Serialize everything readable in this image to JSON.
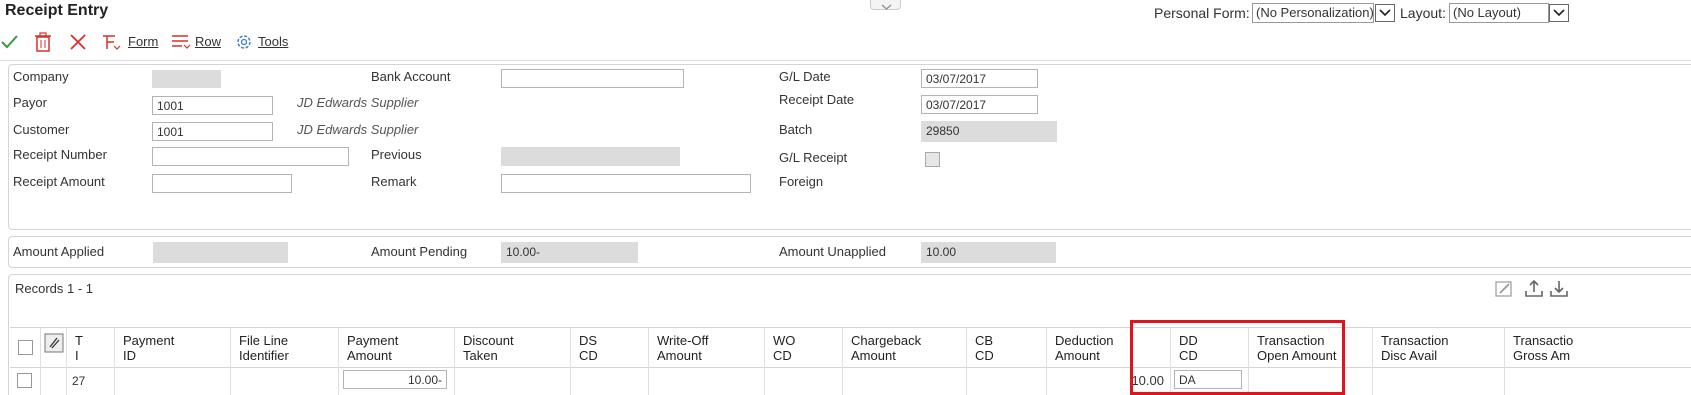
{
  "app": {
    "title": "Receipt Entry"
  },
  "header": {
    "personal_form_label": "Personal Form:",
    "personal_form_value": "(No Personalization)",
    "layout_label": "Layout:",
    "layout_value": "(No Layout)"
  },
  "toolbar": {
    "form_label": "Form",
    "row_label": "Row",
    "tools_label": "Tools"
  },
  "form": {
    "company_label": "Company",
    "payor_label": "Payor",
    "payor_value": "1001",
    "payor_desc": "JD Edwards Supplier",
    "customer_label": "Customer",
    "customer_value": "1001",
    "customer_desc": "JD Edwards Supplier",
    "receipt_number_label": "Receipt Number",
    "receipt_amount_label": "Receipt Amount",
    "bank_account_label": "Bank Account",
    "previous_label": "Previous",
    "remark_label": "Remark",
    "gl_date_label": "G/L Date",
    "gl_date_value": "03/07/2017",
    "receipt_date_label": "Receipt Date",
    "receipt_date_value": "03/07/2017",
    "batch_label": "Batch",
    "batch_value": "29850",
    "gl_receipt_label": "G/L Receipt",
    "foreign_label": "Foreign"
  },
  "totals": {
    "amount_applied_label": "Amount Applied",
    "amount_pending_label": "Amount Pending",
    "amount_pending_value": "10.00-",
    "amount_unapplied_label": "Amount Unapplied",
    "amount_unapplied_value": "10.00"
  },
  "grid": {
    "records_label": "Records 1 - 1",
    "columns": [
      {
        "l1": "T",
        "l2": "I"
      },
      {
        "l1": "Payment",
        "l2": "ID"
      },
      {
        "l1": "File Line",
        "l2": "Identifier"
      },
      {
        "l1": "Payment",
        "l2": "Amount"
      },
      {
        "l1": "Discount",
        "l2": "Taken"
      },
      {
        "l1": "DS",
        "l2": "CD"
      },
      {
        "l1": "Write-Off",
        "l2": "Amount"
      },
      {
        "l1": "WO",
        "l2": "CD"
      },
      {
        "l1": "Chargeback",
        "l2": "Amount"
      },
      {
        "l1": "CB",
        "l2": "CD"
      },
      {
        "l1": "Deduction",
        "l2": "Amount"
      },
      {
        "l1": "DD",
        "l2": "CD"
      },
      {
        "l1": "Transaction",
        "l2": "Open Amount"
      },
      {
        "l1": "Transaction",
        "l2": "Disc Avail"
      },
      {
        "l1": "Transactio",
        "l2": "Gross Am"
      }
    ],
    "row": {
      "ti": "27",
      "payment_amount": "10.00-",
      "deduction_amount": "10.00",
      "dd_cd": "DA"
    }
  },
  "colors": {
    "accent_green": "#3a9a3a",
    "delete_red": "#d9302b",
    "highlight_red": "#e0141f",
    "readonly_gray": "#dcdcdc"
  }
}
